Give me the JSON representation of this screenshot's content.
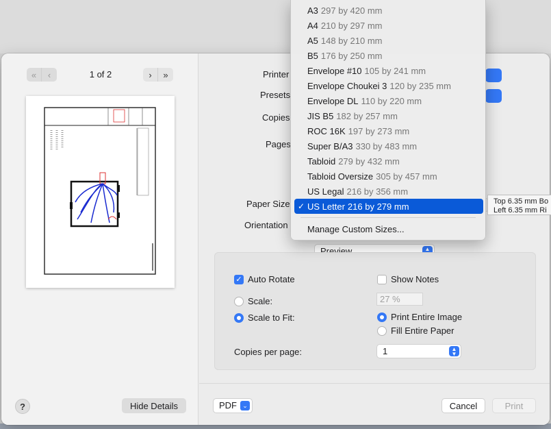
{
  "preview": {
    "page_indicator": "1 of 2",
    "nav_first_icon": "double-chevron-left-icon",
    "nav_prev_icon": "chevron-left-icon",
    "nav_next_icon": "chevron-right-icon",
    "nav_last_icon": "double-chevron-right-icon"
  },
  "form": {
    "printer_label": "Printer",
    "presets_label": "Presets",
    "copies_label": "Copies",
    "pages_label": "Pages",
    "paper_size_label": "Paper Size",
    "orientation_label": "Orientation"
  },
  "paper_menu": {
    "items": [
      {
        "name": "A3",
        "dim": "297 by 420 mm"
      },
      {
        "name": "A4",
        "dim": "210 by 297 mm"
      },
      {
        "name": "A5",
        "dim": "148 by 210 mm"
      },
      {
        "name": "B5",
        "dim": "176 by 250 mm"
      },
      {
        "name": "Envelope #10",
        "dim": "105 by 241 mm"
      },
      {
        "name": "Envelope Choukei 3",
        "dim": "120 by 235 mm"
      },
      {
        "name": "Envelope DL",
        "dim": "110 by 220 mm"
      },
      {
        "name": "JIS B5",
        "dim": "182 by 257 mm"
      },
      {
        "name": "ROC 16K",
        "dim": "197 by 273 mm"
      },
      {
        "name": "Super B/A3",
        "dim": "330 by 483 mm"
      },
      {
        "name": "Tabloid",
        "dim": "279 by 432 mm"
      },
      {
        "name": "Tabloid Oversize",
        "dim": "305 by 457 mm"
      },
      {
        "name": "US Legal",
        "dim": "216 by 356 mm"
      },
      {
        "name": "US Letter",
        "dim": "216 by 279 mm",
        "selected": true
      }
    ],
    "check_mark": "✓",
    "manage_label": "Manage Custom Sizes..."
  },
  "tooltip": {
    "line1": "Top 6.35 mm Bo",
    "line2": "Left 6.35 mm Ri"
  },
  "section_popup": {
    "value": "Preview"
  },
  "options": {
    "auto_rotate": {
      "label": "Auto Rotate",
      "checked": true
    },
    "show_notes": {
      "label": "Show Notes",
      "checked": false
    },
    "scale_label": "Scale:",
    "scale_value": "27 %",
    "scale_to_fit_label": "Scale to Fit:",
    "print_entire_image_label": "Print Entire Image",
    "fill_entire_paper_label": "Fill Entire Paper",
    "copies_per_page_label": "Copies per page:",
    "copies_per_page_value": "1"
  },
  "footer": {
    "help": "?",
    "hide_details": "Hide Details",
    "pdf": "PDF",
    "cancel": "Cancel",
    "print": "Print"
  },
  "colors": {
    "accent": "#3478f6",
    "menu_highlight": "#0a5ad8"
  }
}
